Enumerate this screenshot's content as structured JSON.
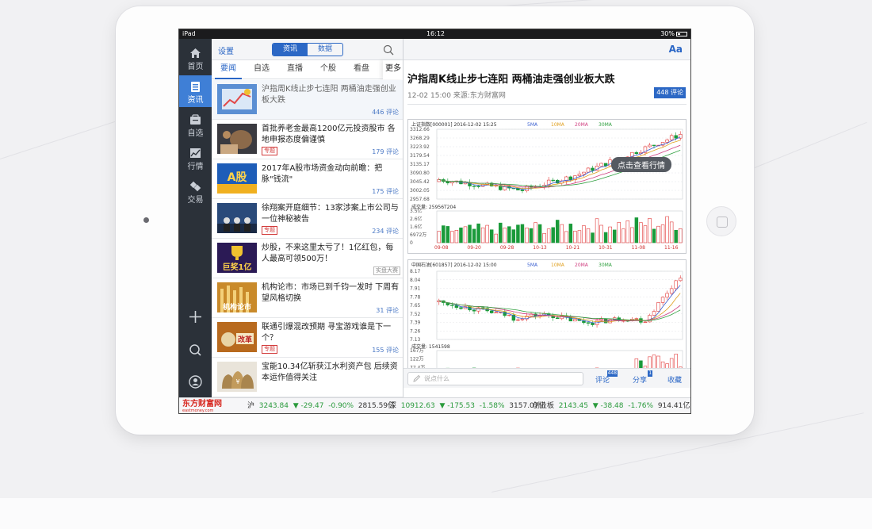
{
  "status_bar": {
    "device": "iPad",
    "time": "16:12",
    "battery": "30%"
  },
  "sidebar": {
    "items": [
      {
        "label": "首页",
        "icon": "home-icon"
      },
      {
        "label": "资讯",
        "icon": "news-icon",
        "active": true
      },
      {
        "label": "自选",
        "icon": "watchlist-icon"
      },
      {
        "label": "行情",
        "icon": "market-chart-icon"
      },
      {
        "label": "交易",
        "icon": "trade-icon"
      }
    ]
  },
  "list_header": {
    "settings": "设置",
    "segment": [
      "资讯",
      "数据"
    ]
  },
  "tabs": [
    "要闻",
    "自选",
    "直播",
    "个股",
    "看盘",
    "更多"
  ],
  "news": [
    {
      "title": "沪指周K线止步七连阳 两桶油走强创业板大跌",
      "count": "446 评论"
    },
    {
      "title": "首批养老金最高1200亿元投资股市 各地申报态度偏谨慎",
      "count": "179 评论",
      "tag": "专题"
    },
    {
      "title": "2017年A股市场资金动向前瞻：把脉\"钱流\"",
      "count": "175 评论",
      "thumb_text": "A股"
    },
    {
      "title": "徐翔案开庭细节：13家涉案上市公司与一位神秘被告",
      "count": "234 评论",
      "tag": "专题"
    },
    {
      "title": "炒股，不来这里太亏了！1亿红包，每人最高可领500万！",
      "tag2": "实盘大赛",
      "thumb_text": "巨奖1亿"
    },
    {
      "title": "机构论市：市场已到千钧一发时 下周有望风格切换",
      "count": "31 评论",
      "thumb_text": "机构论市"
    },
    {
      "title": "联通引爆混改预期 寻宝游戏谁是下一个？",
      "count": "155 评论",
      "tag": "专题",
      "thumb_text": "改革"
    },
    {
      "title": "宝能10.34亿斩获江水利资产包 后续资本运作值得关注"
    }
  ],
  "article": {
    "title": "沪指周K线止步七连阳 两桶油走强创业板大跌",
    "meta": "12-02 15:00  来源:东方财富网",
    "comments": "448 评论",
    "cta": "点击查看行情",
    "font_button": "Aa"
  },
  "chart_data": [
    {
      "type": "candlestick",
      "title": "上证指数[000001] 2016-12-02 15:25",
      "legend": [
        "5MA",
        "10MA",
        "20MA",
        "30MA"
      ],
      "yticks": [
        "3312.66",
        "3268.29",
        "3223.92",
        "3179.54",
        "3135.17",
        "3090.80",
        "3045.42",
        "3002.05",
        "2957.68"
      ],
      "volume_label": "成交量: 25956T204",
      "volume_ticks": [
        "3.5亿",
        "2.6亿",
        "1.6亿",
        "6972万",
        "0"
      ],
      "xticks": [
        "09-08",
        "09-20",
        "09-28",
        "10-13",
        "10-21",
        "10-31",
        "11-08",
        "11-16"
      ],
      "series": [
        {
          "name": "5MA",
          "color": "#3a5fd0"
        },
        {
          "name": "10MA",
          "color": "#e0a020"
        },
        {
          "name": "20MA",
          "color": "#d04080"
        },
        {
          "name": "30MA",
          "color": "#30a040"
        }
      ]
    },
    {
      "type": "candlestick",
      "title": "中国石油[601857] 2016-12-02 15:00",
      "legend": [
        "5MA",
        "10MA",
        "20MA",
        "30MA"
      ],
      "yticks": [
        "8.17",
        "8.04",
        "7.91",
        "7.78",
        "7.65",
        "7.52",
        "7.39",
        "7.26",
        "7.13"
      ],
      "volume_label": "成交量: 1541598",
      "volume_ticks": [
        "167万",
        "122万",
        "77.4万",
        "32.7万"
      ]
    }
  ],
  "bottom_bar": {
    "placeholder": "说点什么",
    "comment_btn": "评论",
    "comment_count": "448",
    "share_btn": "分享",
    "share_count": "1",
    "fav_btn": "收藏"
  },
  "ticker": {
    "logo": "东方财富网",
    "logo_sub": "eastmoney.com",
    "items": [
      {
        "name": "沪",
        "value": "3243.84",
        "change": "-29.47",
        "pct": "-0.90%",
        "amount": "2815.59亿"
      },
      {
        "name": "深",
        "value": "10912.63",
        "change": "-175.53",
        "pct": "-1.58%",
        "amount": "3157.07亿"
      },
      {
        "name": "创业板",
        "value": "2143.45",
        "change": "-38.48",
        "pct": "-1.76%",
        "amount": "914.41亿"
      }
    ]
  }
}
